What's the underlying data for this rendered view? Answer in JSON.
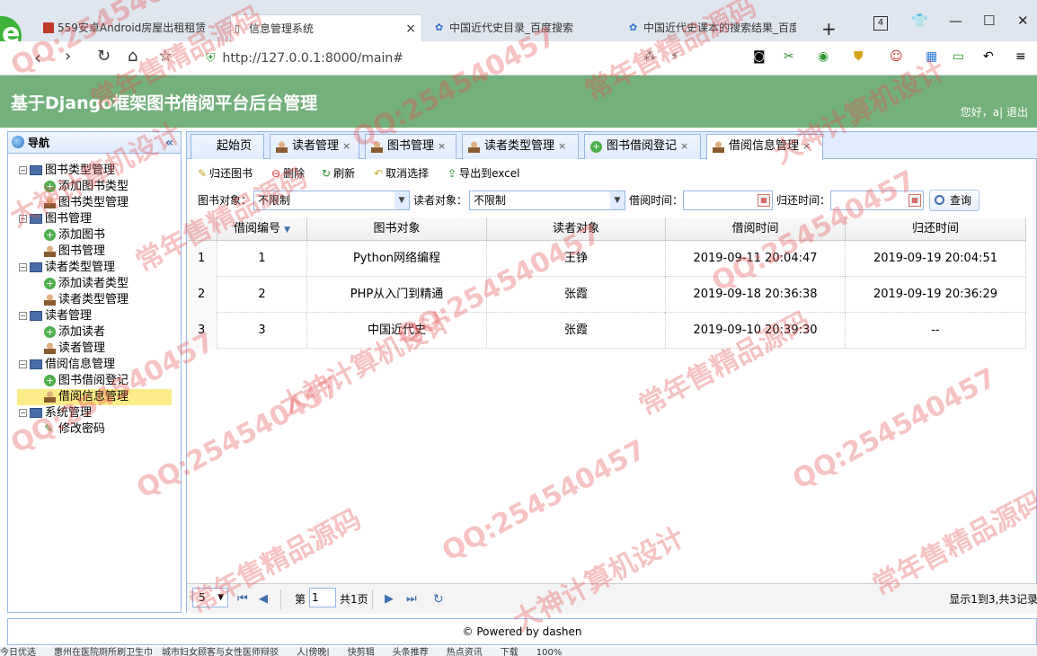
{
  "browser": {
    "tabs": [
      {
        "label": "559安卓Android房屋出租租赁",
        "favicon": "red-square-icon"
      },
      {
        "label": "信息管理系统",
        "favicon": "page-icon",
        "active": true
      },
      {
        "label": "中国近代史目录_百度搜索",
        "favicon": "baidu-paw-icon"
      },
      {
        "label": "中国近代史课本的搜索结果_百度",
        "favicon": "baidu-paw-icon"
      }
    ],
    "tab_count": "4",
    "url": "http://127.0.0.1:8000/main#"
  },
  "app": {
    "title": "基于Django框架图书借阅平台后台管理",
    "welcome": "您好，a| 退出"
  },
  "sidebar": {
    "title": "导航",
    "groups": [
      {
        "label": "图书类型管理",
        "items": [
          "添加图书类型",
          "图书类型管理"
        ]
      },
      {
        "label": "图书管理",
        "items": [
          "添加图书",
          "图书管理"
        ]
      },
      {
        "label": "读者类型管理",
        "items": [
          "添加读者类型",
          "读者类型管理"
        ]
      },
      {
        "label": "读者管理",
        "items": [
          "添加读者",
          "读者管理"
        ]
      },
      {
        "label": "借阅信息管理",
        "items": [
          "图书借阅登记",
          "借阅信息管理"
        ]
      },
      {
        "label": "系统管理",
        "items": [
          "修改密码"
        ]
      }
    ],
    "selected": "借阅信息管理"
  },
  "page_tabs": [
    "起始页",
    "读者管理",
    "图书管理",
    "读者类型管理",
    "图书借阅登记",
    "借阅信息管理"
  ],
  "toolbar": {
    "return_book": "归还图书",
    "delete": "删除",
    "refresh": "刷新",
    "cancel_select": "取消选择",
    "export_excel": "导出到excel"
  },
  "filter": {
    "book_label": "图书对象：",
    "book_value": "不限制",
    "reader_label": "读者对象：",
    "reader_value": "不限制",
    "borrow_time_label": "借阅时间：",
    "return_time_label": "归还时间：",
    "query_button": "查询"
  },
  "table": {
    "columns": [
      "借阅编号",
      "图书对象",
      "读者对象",
      "借阅时间",
      "归还时间"
    ],
    "rows": [
      {
        "rownum": "1",
        "id": "1",
        "book": "Python网络编程",
        "reader": "王铮",
        "borrow": "2019-09-11 20:04:47",
        "return": "2019-09-19 20:04:51"
      },
      {
        "rownum": "2",
        "id": "2",
        "book": "PHP从入门到精通",
        "reader": "张霞",
        "borrow": "2019-09-18 20:36:38",
        "return": "2019-09-19 20:36:29"
      },
      {
        "rownum": "3",
        "id": "3",
        "book": "中国近代史",
        "reader": "张霞",
        "borrow": "2019-09-10 20:39:30",
        "return": "--"
      }
    ]
  },
  "pager": {
    "page_size": "5",
    "page_prefix": "第",
    "page_value": "1",
    "page_total": "共1页",
    "summary": "显示1到3,共3记录"
  },
  "footer": "© Powered by dashen",
  "statusbar": "今日优选　　惠州在医院厕所刷卫生巾　城市妇女顾客与女性医师辩驳　　人|傍晚|　　快剪辑　　头条推荐　　热点资讯　　下载　　100%",
  "watermarks": [
    "QQ:254540457",
    "大神计算机设计",
    "常年售精品源码"
  ]
}
